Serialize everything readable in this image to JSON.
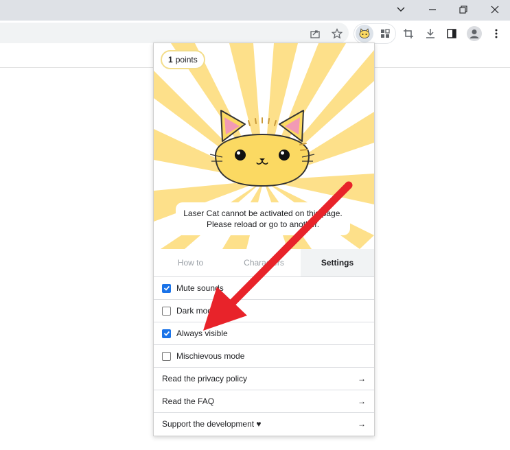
{
  "window": {
    "minimize_icon": "chevron-down-icon",
    "buttons": [
      "minimize-icon",
      "restore-icon",
      "close-icon"
    ]
  },
  "toolbar": {
    "icons": [
      "share-icon",
      "star-icon",
      "laser-cat-extension-icon",
      "extensions-puzzle-icon",
      "crop-icon",
      "download-icon",
      "side-panel-icon",
      "profile-icon",
      "more-menu-icon"
    ]
  },
  "popup": {
    "points": {
      "value": "1",
      "label": "points"
    },
    "notice": {
      "line1": "Laser Cat cannot be activated on this page.",
      "line2": "Please reload or go to another."
    },
    "tabs": [
      {
        "label": "How to",
        "active": false
      },
      {
        "label": "Characters",
        "active": false
      },
      {
        "label": "Settings",
        "active": true
      }
    ],
    "settings": [
      {
        "label": "Mute sounds",
        "checked": true
      },
      {
        "label": "Dark mode",
        "checked": false
      },
      {
        "label": "Always visible",
        "checked": true
      },
      {
        "label": "Mischievous mode",
        "checked": false
      }
    ],
    "links": [
      {
        "label": "Read the privacy policy",
        "arrow": "→"
      },
      {
        "label": "Read the FAQ",
        "arrow": "→"
      },
      {
        "label": "Support the development ♥",
        "arrow": "→"
      }
    ]
  },
  "colors": {
    "ray_yellow": "#fde08a",
    "cat_fill": "#fbd962",
    "checkbox_blue": "#1a73e8",
    "annotation_red": "#e8232a"
  }
}
